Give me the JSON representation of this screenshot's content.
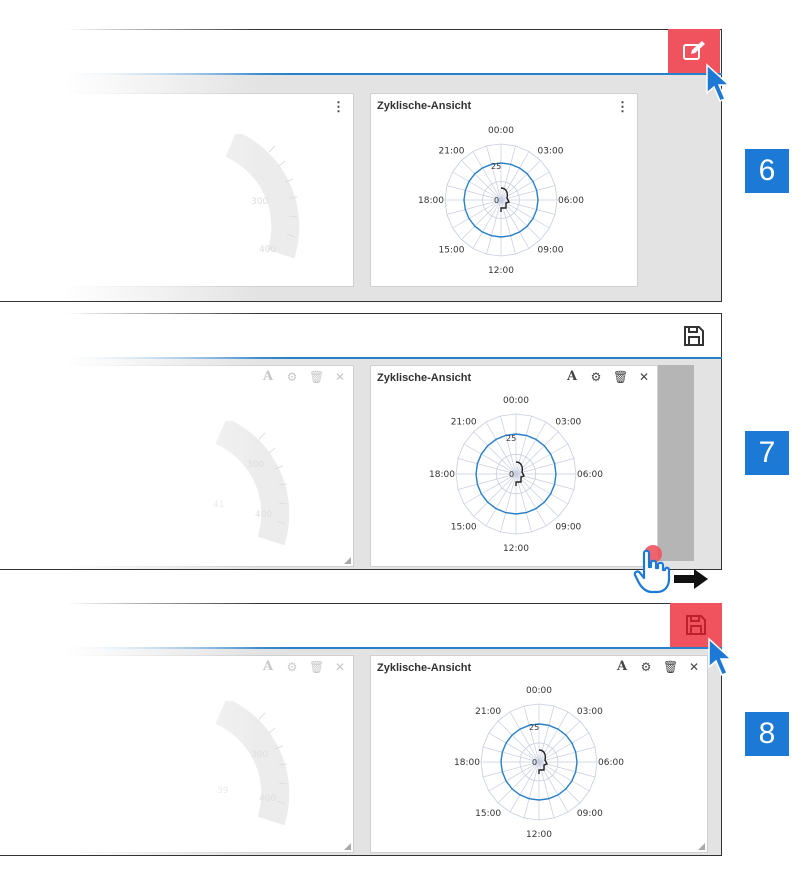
{
  "widget": {
    "title": "Zyklische-Ansicht",
    "hour_labels": [
      "00:00",
      "03:00",
      "06:00",
      "09:00",
      "12:00",
      "15:00",
      "18:00",
      "21:00"
    ],
    "ring_label_outer": "25",
    "ring_label_center": "0",
    "ghost_gauge_labels": [
      "300",
      "400"
    ],
    "ghost_gauge_labels_panel3": [
      "300",
      "400",
      "39"
    ],
    "ghost_gauge_label_panel2_extra": "41"
  },
  "toolbar": {
    "font_icon_glyph": "A",
    "close_glyph": "✕"
  },
  "steps": [
    "6",
    "7",
    "8"
  ],
  "colors": {
    "accent_blue": "#2980c8",
    "edit_red": "#f0525e",
    "step_blue": "#1c7ad6"
  }
}
